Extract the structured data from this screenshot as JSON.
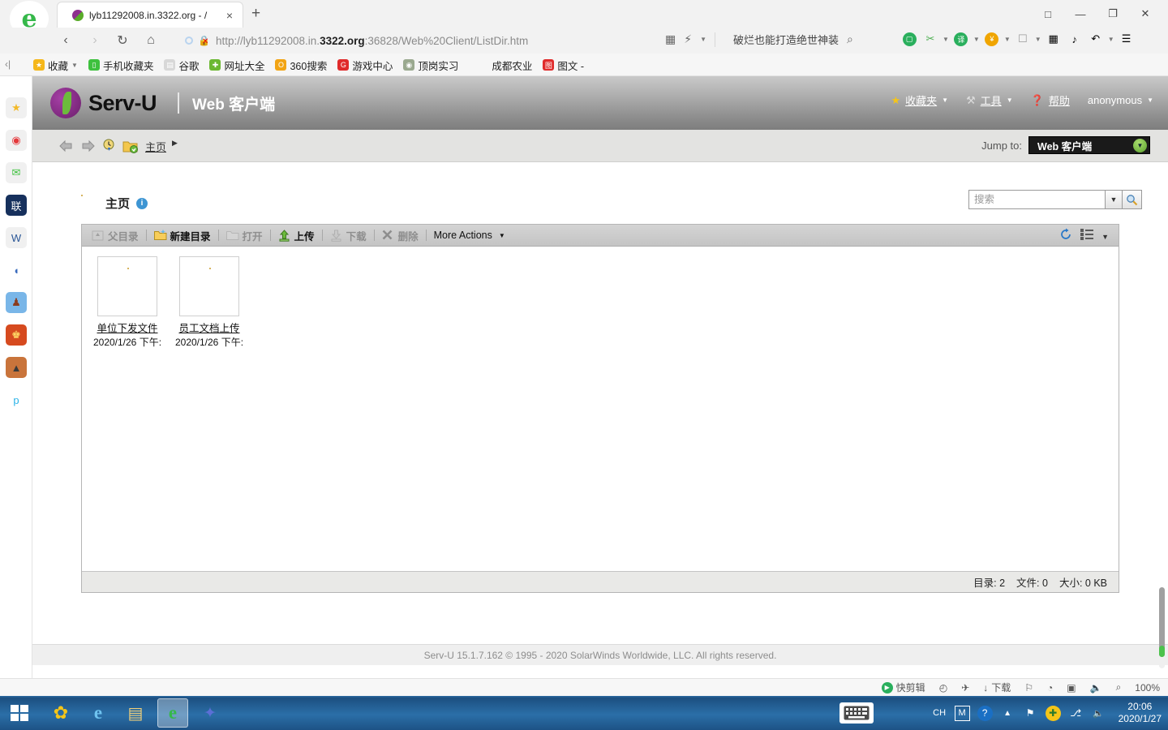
{
  "browser": {
    "tab": {
      "title": "lyb11292008.in.3322.org - /",
      "close": "×"
    },
    "new_tab": "+",
    "window_controls": {
      "skin": "□",
      "minimize": "—",
      "restore": "❐",
      "close": "✕"
    },
    "nav": {
      "back": "‹",
      "forward": "›",
      "reload": "↻",
      "home": "⌂"
    },
    "url": {
      "prefix": "http://lyb11292008.in.",
      "bold": "3322.org",
      "suffix": ":36828/Web%20Client/ListDir.htm",
      "full": "http://lyb11292008.in.3322.org:36828/Web%20Client/ListDir.htm"
    },
    "ad_text": "破烂也能打造绝世神装",
    "zoom": "100%",
    "bookmarks": [
      {
        "label": "收藏",
        "icon": "star-icon",
        "color": "#f5b71a",
        "glyph": "★",
        "has_caret": true
      },
      {
        "label": "手机收藏夹",
        "icon": "phone-icon",
        "color": "#3ec13e",
        "glyph": "▯",
        "has_caret": false
      },
      {
        "label": "谷歌",
        "icon": "page-icon",
        "color": "#d8d8d8",
        "glyph": "▤",
        "has_caret": false
      },
      {
        "label": "网址大全",
        "icon": "plus-circle-icon",
        "color": "#6cb832",
        "glyph": "✚",
        "has_caret": false
      },
      {
        "label": "360搜索",
        "icon": "search-circle-icon",
        "color": "#f2a414",
        "glyph": "O",
        "has_caret": false
      },
      {
        "label": "游戏中心",
        "icon": "game-icon",
        "color": "#e02b2b",
        "glyph": "G",
        "has_caret": false
      },
      {
        "label": "顶岗实习",
        "icon": "school-icon",
        "color": "#9aa98f",
        "glyph": "◉",
        "has_caret": false
      },
      {
        "label": "成都农业",
        "icon": "link-icon",
        "color": "transparent",
        "glyph": "",
        "has_caret": false
      },
      {
        "label": "图文 -",
        "icon": "doc-icon",
        "color": "#e02b2b",
        "glyph": "图",
        "has_caret": false
      }
    ]
  },
  "sidebar": {
    "items": [
      {
        "name": "favorites",
        "glyph": "★",
        "bg": "#f0f0f0",
        "fg": "#f3ba2a"
      },
      {
        "name": "weibo",
        "glyph": "◉",
        "bg": "#f0f0f0",
        "fg": "#e4393c"
      },
      {
        "name": "mail",
        "glyph": "✉",
        "bg": "#f0f0f0",
        "fg": "#3ec13e"
      },
      {
        "name": "study-app",
        "glyph": "联",
        "bg": "#16305c",
        "fg": "#ffffff"
      },
      {
        "name": "word-doc",
        "glyph": "W",
        "bg": "#f0f0f0",
        "fg": "#2b5797"
      },
      {
        "name": "blue-app",
        "glyph": "◖",
        "bg": "#ffffff",
        "fg": "#3a6bbd"
      },
      {
        "name": "game-pirate",
        "glyph": "♟",
        "bg": "#79b6e8",
        "fg": "#8a3b1e"
      },
      {
        "name": "game-king",
        "glyph": "♚",
        "bg": "#d64a1f",
        "fg": "#ffd966"
      },
      {
        "name": "game-tank",
        "glyph": "▲",
        "bg": "#c9743b",
        "fg": "#3a3a3a"
      },
      {
        "name": "baidu-p",
        "glyph": "p",
        "bg": "#ffffff",
        "fg": "#2ab3e8"
      }
    ]
  },
  "servu": {
    "logo_text": "Serv-U",
    "subtitle": "Web 客户端",
    "menu": [
      {
        "label": "收藏夹",
        "icon": "star-icon",
        "glyph": "★",
        "color": "#f5c518",
        "caret": true
      },
      {
        "label": "工具",
        "icon": "tools-icon",
        "glyph": "⚒",
        "color": "#dcdcdc",
        "caret": true
      },
      {
        "label": "帮助",
        "icon": "help-icon",
        "glyph": "❓",
        "color": "#d03b3b",
        "caret": false
      },
      {
        "label": "anonymous",
        "icon": "user-icon",
        "glyph": "",
        "color": "#ffffff",
        "caret": true
      }
    ],
    "nav": {
      "back": "back-arrow-icon",
      "forward": "forward-arrow-icon",
      "history": "history-clock-icon",
      "refresh_dir": "refresh-folder-icon",
      "breadcrumb": "主页"
    },
    "jump": {
      "label": "Jump to:",
      "value": "Web 客户端"
    },
    "page_title": "主页",
    "search": {
      "placeholder": "搜索",
      "value": ""
    },
    "toolbar": [
      {
        "label": "父目录",
        "icon": "parent-dir-icon",
        "enabled": false
      },
      {
        "label": "新建目录",
        "icon": "new-folder-icon",
        "enabled": true
      },
      {
        "label": "打开",
        "icon": "open-folder-icon",
        "enabled": false
      },
      {
        "label": "上传",
        "icon": "upload-icon",
        "enabled": true
      },
      {
        "label": "下载",
        "icon": "download-icon",
        "enabled": false
      },
      {
        "label": "删除",
        "icon": "delete-x-icon",
        "enabled": false
      },
      {
        "label": "More Actions",
        "icon": "caret-down-icon",
        "enabled": true
      }
    ],
    "toolbar_right": {
      "refresh": "refresh-icon",
      "view": "list-view-icon",
      "caret": "caret-down-icon"
    },
    "files": [
      {
        "name": "单位下发文件",
        "date": "2020/1/26 下午:",
        "type": "folder"
      },
      {
        "name": "员工文档上传",
        "date": "2020/1/26 下午:",
        "type": "folder"
      }
    ],
    "status": {
      "dirs": "目录: 2",
      "files": "文件: 0",
      "size": "大小: 0 KB"
    },
    "footer": "Serv-U 15.1.7.162 © 1995 - 2020 SolarWinds Worldwide, LLC. All rights reserved."
  },
  "statusbar": {
    "items": [
      {
        "label": "快剪辑",
        "icon": "play-circle-icon",
        "glyph": "▶"
      },
      {
        "label": "",
        "icon": "speed-icon",
        "glyph": "◴"
      },
      {
        "label": "",
        "icon": "rocket-icon",
        "glyph": "✈"
      },
      {
        "label": "下载",
        "icon": "download-arrow-icon",
        "glyph": "↓"
      },
      {
        "label": "",
        "icon": "flag-icon",
        "glyph": "⚐"
      },
      {
        "label": "",
        "icon": "shield-icon",
        "glyph": "◔"
      },
      {
        "label": "",
        "icon": "window-icon",
        "glyph": "▣"
      },
      {
        "label": "",
        "icon": "volume-icon",
        "glyph": "🔈"
      },
      {
        "label": "",
        "icon": "search-icon",
        "glyph": "⌕"
      },
      {
        "label": "100%",
        "icon": "zoom-level",
        "glyph": ""
      }
    ]
  },
  "taskbar": {
    "apps": [
      {
        "name": "360-safe",
        "glyph": "✿",
        "active": false
      },
      {
        "name": "internet-explorer",
        "glyph": "e",
        "active": false
      },
      {
        "name": "file-explorer",
        "glyph": "▤",
        "active": false
      },
      {
        "name": "360-browser",
        "glyph": "e",
        "active": true
      },
      {
        "name": "bird-app",
        "glyph": "✦",
        "active": false
      }
    ],
    "tray": {
      "ime_lang": "CH",
      "ime_mode": "M",
      "help": "?",
      "show_hidden": "▲",
      "network_flag": "⚑",
      "security": "✚",
      "network": "⎇",
      "volume": "🔈"
    },
    "clock": {
      "time": "20:06",
      "date": "2020/1/27"
    }
  }
}
